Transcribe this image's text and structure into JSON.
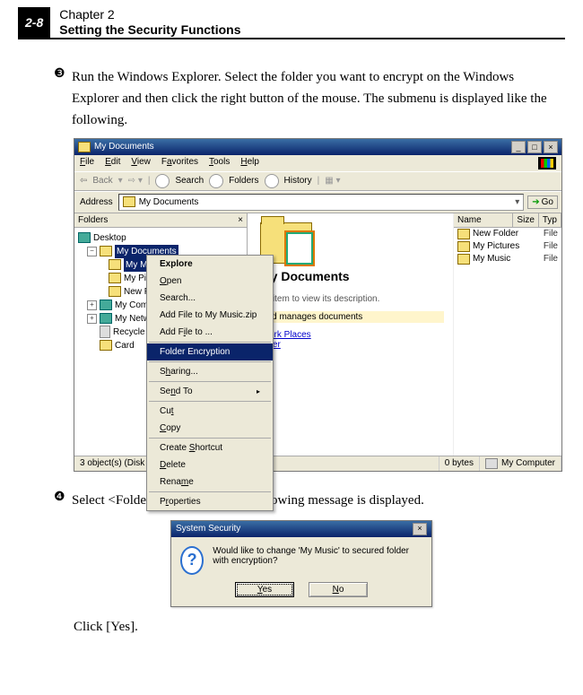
{
  "header": {
    "page_number": "2-8",
    "chapter": "Chapter 2",
    "subtitle": "Setting the Security Functions"
  },
  "step3": {
    "bullet": "❸",
    "text": "Run the Windows Explorer. Select the folder you want to encrypt on the Windows Explorer and then click the right button of the mouse. The submenu is displayed like the following."
  },
  "explorer": {
    "title": "My Documents",
    "menus": {
      "file": "File",
      "edit": "Edit",
      "view": "View",
      "fav": "Favorites",
      "tools": "Tools",
      "help": "Help"
    },
    "toolbar": {
      "back": "Back",
      "search": "Search",
      "folders": "Folders",
      "history": "History"
    },
    "address_label": "Address",
    "address_value": "My Documents",
    "go": "Go",
    "folders_label": "Folders",
    "tree": {
      "desktop": "Desktop",
      "mydocs": "My Documents",
      "mymusic": "My Mu",
      "mypics": "My Pic",
      "newfolder": "New Fo",
      "mycomputer": "My Compu",
      "mynetwork": "My Networ",
      "recycle": "Recycle Bi",
      "card": "Card"
    },
    "columns": {
      "name": "Name",
      "size": "Size",
      "type": "Typ"
    },
    "files": {
      "newfolder": {
        "name": "New Folder",
        "type": "File"
      },
      "mypics": {
        "name": "My Pictures",
        "type": "File"
      },
      "mymusic": {
        "name": "My Music",
        "type": "File"
      }
    },
    "main_title": "My Documents",
    "main_hint": "an item to view its description.",
    "main_desc": "and manages documents",
    "link_netplaces": "twork Places",
    "link_computer": "puter",
    "status_left": "3 object(s) (Disk free space: 11.1 GB)",
    "status_bytes": "0 bytes",
    "status_loc": "My Computer",
    "context": {
      "explore": "Explore",
      "open": "Open",
      "search": "Search...",
      "addzip": "Add File to My Music.zip",
      "addfile": "Add File to ...",
      "folderenc": "Folder Encryption",
      "sharing": "Sharing...",
      "sendto": "Send To",
      "cut": "Cut",
      "copy": "Copy",
      "shortcut": "Create Shortcut",
      "delete": "Delete",
      "rename": "Rename",
      "props": "Properties"
    }
  },
  "step4": {
    "bullet": "❹",
    "text": "Select <Folder Encryption>. The following message is displayed."
  },
  "dialog": {
    "title": "System Security",
    "message": "Would like to change 'My Music' to secured folder with encryption?",
    "yes": "Yes",
    "no": "No"
  },
  "click_yes": "Click [Yes]."
}
